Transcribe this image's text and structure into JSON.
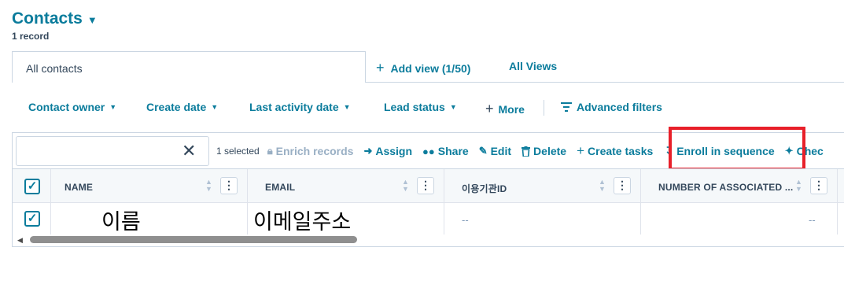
{
  "header": {
    "title": "Contacts",
    "record_count": "1 record"
  },
  "views": {
    "active_tab": "All contacts",
    "add_view": "Add view (1/50)",
    "all_views": "All Views"
  },
  "filters": {
    "contact_owner": "Contact owner",
    "create_date": "Create date",
    "last_activity_date": "Last activity date",
    "lead_status": "Lead status",
    "more": "More",
    "advanced_filters": "Advanced filters"
  },
  "search": {
    "value": "",
    "placeholder": ""
  },
  "bulk_actions": {
    "selected": "1 selected",
    "enrich_records": "Enrich records",
    "assign": "Assign",
    "share": "Share",
    "edit": "Edit",
    "delete": "Delete",
    "create_tasks": "Create tasks",
    "enroll_in_sequence": "Enroll in sequence",
    "check_truncated": "Chec"
  },
  "table": {
    "columns": [
      "NAME",
      "EMAIL",
      "이용기관ID",
      "NUMBER OF ASSOCIATED ..."
    ],
    "rows": [
      {
        "name": "이름",
        "email": "이메일주소",
        "org_id": "--",
        "associated": "--"
      }
    ]
  },
  "colors": {
    "accent": "#0b7c9c",
    "text": "#33475b",
    "border": "#cbd6e2",
    "highlight": "#e8202a"
  },
  "icons": [
    "chevron-down-icon",
    "plus-icon",
    "filter-lines-icon",
    "close-icon",
    "lock-icon",
    "arrow-right-icon",
    "people-icon",
    "pencil-icon",
    "trash-icon",
    "sequence-icon",
    "sparkle-icon",
    "sort-icon",
    "kebab-menu-icon",
    "checkbox-checked-icon"
  ]
}
